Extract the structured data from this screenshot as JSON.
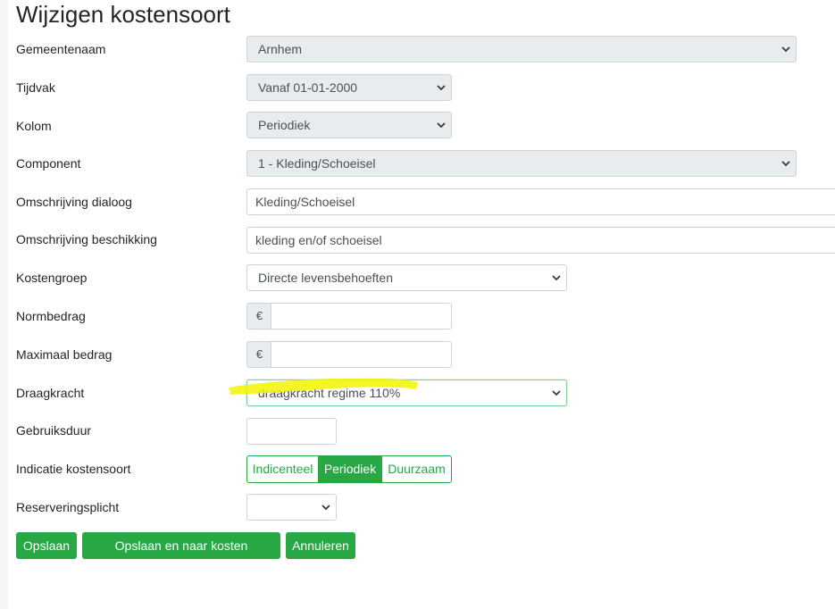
{
  "page": {
    "title": "Wijzigen kostensoort"
  },
  "form": {
    "gemeentenaam": {
      "label": "Gemeentenaam",
      "value": "Arnhem"
    },
    "tijdvak": {
      "label": "Tijdvak",
      "value": "Vanaf 01-01-2000"
    },
    "kolom": {
      "label": "Kolom",
      "value": "Periodiek"
    },
    "component": {
      "label": "Component",
      "value": "1 - Kleding/Schoeisel"
    },
    "omschrijving_dialoog": {
      "label": "Omschrijving dialoog",
      "value": "Kleding/Schoeisel"
    },
    "omschrijving_beschikking": {
      "label": "Omschrijving beschikking",
      "value": "kleding en/of schoeisel"
    },
    "kostengroep": {
      "label": "Kostengroep",
      "value": "Directe levensbehoeften"
    },
    "normbedrag": {
      "label": "Normbedrag",
      "prefix": "€",
      "value": ""
    },
    "maximaal_bedrag": {
      "label": "Maximaal bedrag",
      "prefix": "€",
      "value": ""
    },
    "draagkracht": {
      "label": "Draagkracht",
      "value": "draagkracht regime 110%"
    },
    "gebruiksduur": {
      "label": "Gebruiksduur",
      "value": ""
    },
    "indicatie_kostensoort": {
      "label": "Indicatie kostensoort",
      "options": [
        "Indicenteel",
        "Periodiek",
        "Duurzaam"
      ],
      "selected": "Periodiek"
    },
    "reserveringsplicht": {
      "label": "Reserveringsplicht",
      "value": ""
    }
  },
  "buttons": {
    "save": "Opslaan",
    "save_and_go": "Opslaan en naar kosten onderdelen",
    "cancel": "Annuleren"
  },
  "colors": {
    "primary": "#28a745",
    "highlighter": "#f5f500"
  }
}
